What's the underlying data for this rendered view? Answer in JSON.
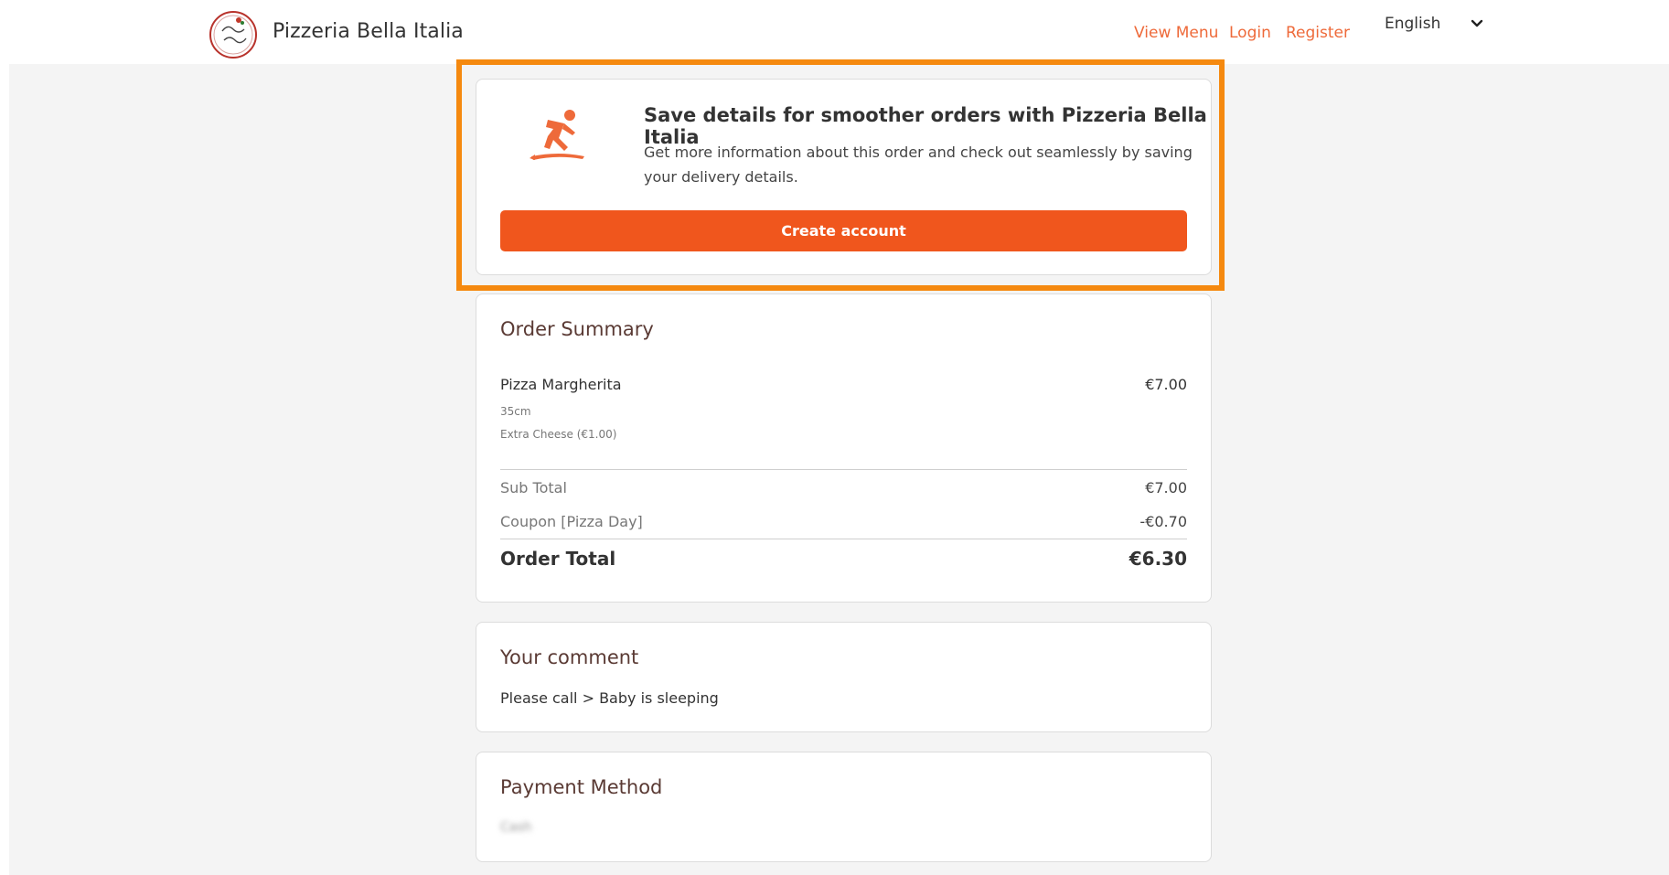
{
  "header": {
    "brand": "Pizzeria Bella Italia",
    "nav": {
      "view_menu": "View Menu",
      "login": "Login",
      "register": "Register"
    },
    "language": {
      "selected": "English"
    }
  },
  "promo": {
    "title": "Save details for smoother orders with Pizzeria Bella Italia",
    "text": "Get more information about this order and check out seamlessly by saving your delivery details.",
    "button_label": "Create account",
    "icon": "surfer-icon"
  },
  "order_summary": {
    "title": "Order Summary",
    "item": {
      "name": "Pizza Margherita",
      "price": "€7.00",
      "size": "35cm",
      "extra": "Extra Cheese  (€1.00)"
    },
    "sub_total_label": "Sub Total",
    "sub_total_value": "€7.00",
    "coupon_label": "Coupon [Pizza Day]",
    "coupon_value": "-€0.70",
    "total_label": "Order Total",
    "total_value": "€6.30"
  },
  "comment": {
    "title": "Your comment",
    "text": "Please call > Baby is sleeping"
  },
  "payment": {
    "title": "Payment Method",
    "value": "Cash"
  },
  "colors": {
    "accent": "#f0561d",
    "link": "#ee6a3a",
    "highlight": "#f5890f",
    "background": "#f4f4f4"
  }
}
